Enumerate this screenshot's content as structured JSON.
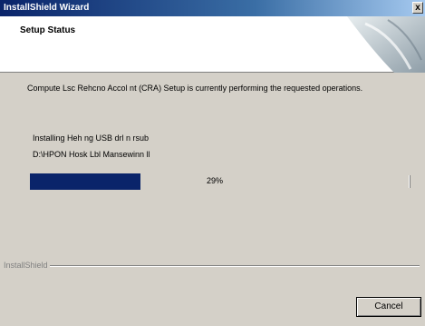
{
  "window": {
    "title": "InstallShield Wizard",
    "close_glyph": "x"
  },
  "header": {
    "title": "Setup Status"
  },
  "description": "Compute Lsc Rehcno Accol nt (CRA) Setup is currently performing the requested operations.",
  "status": {
    "line1": "Installing Heh ng USB drl n rsub",
    "line2": "D:\\HPON Hosk Lbl Mansewinn ll"
  },
  "progress": {
    "value": 0.29,
    "label": "29%"
  },
  "footer": {
    "brand": "InstallShield",
    "cancel_label": "Cancel"
  },
  "colors": {
    "title_start": "#0a246a",
    "progress_fill": "#0a246a",
    "face": "#d4d0c8"
  }
}
